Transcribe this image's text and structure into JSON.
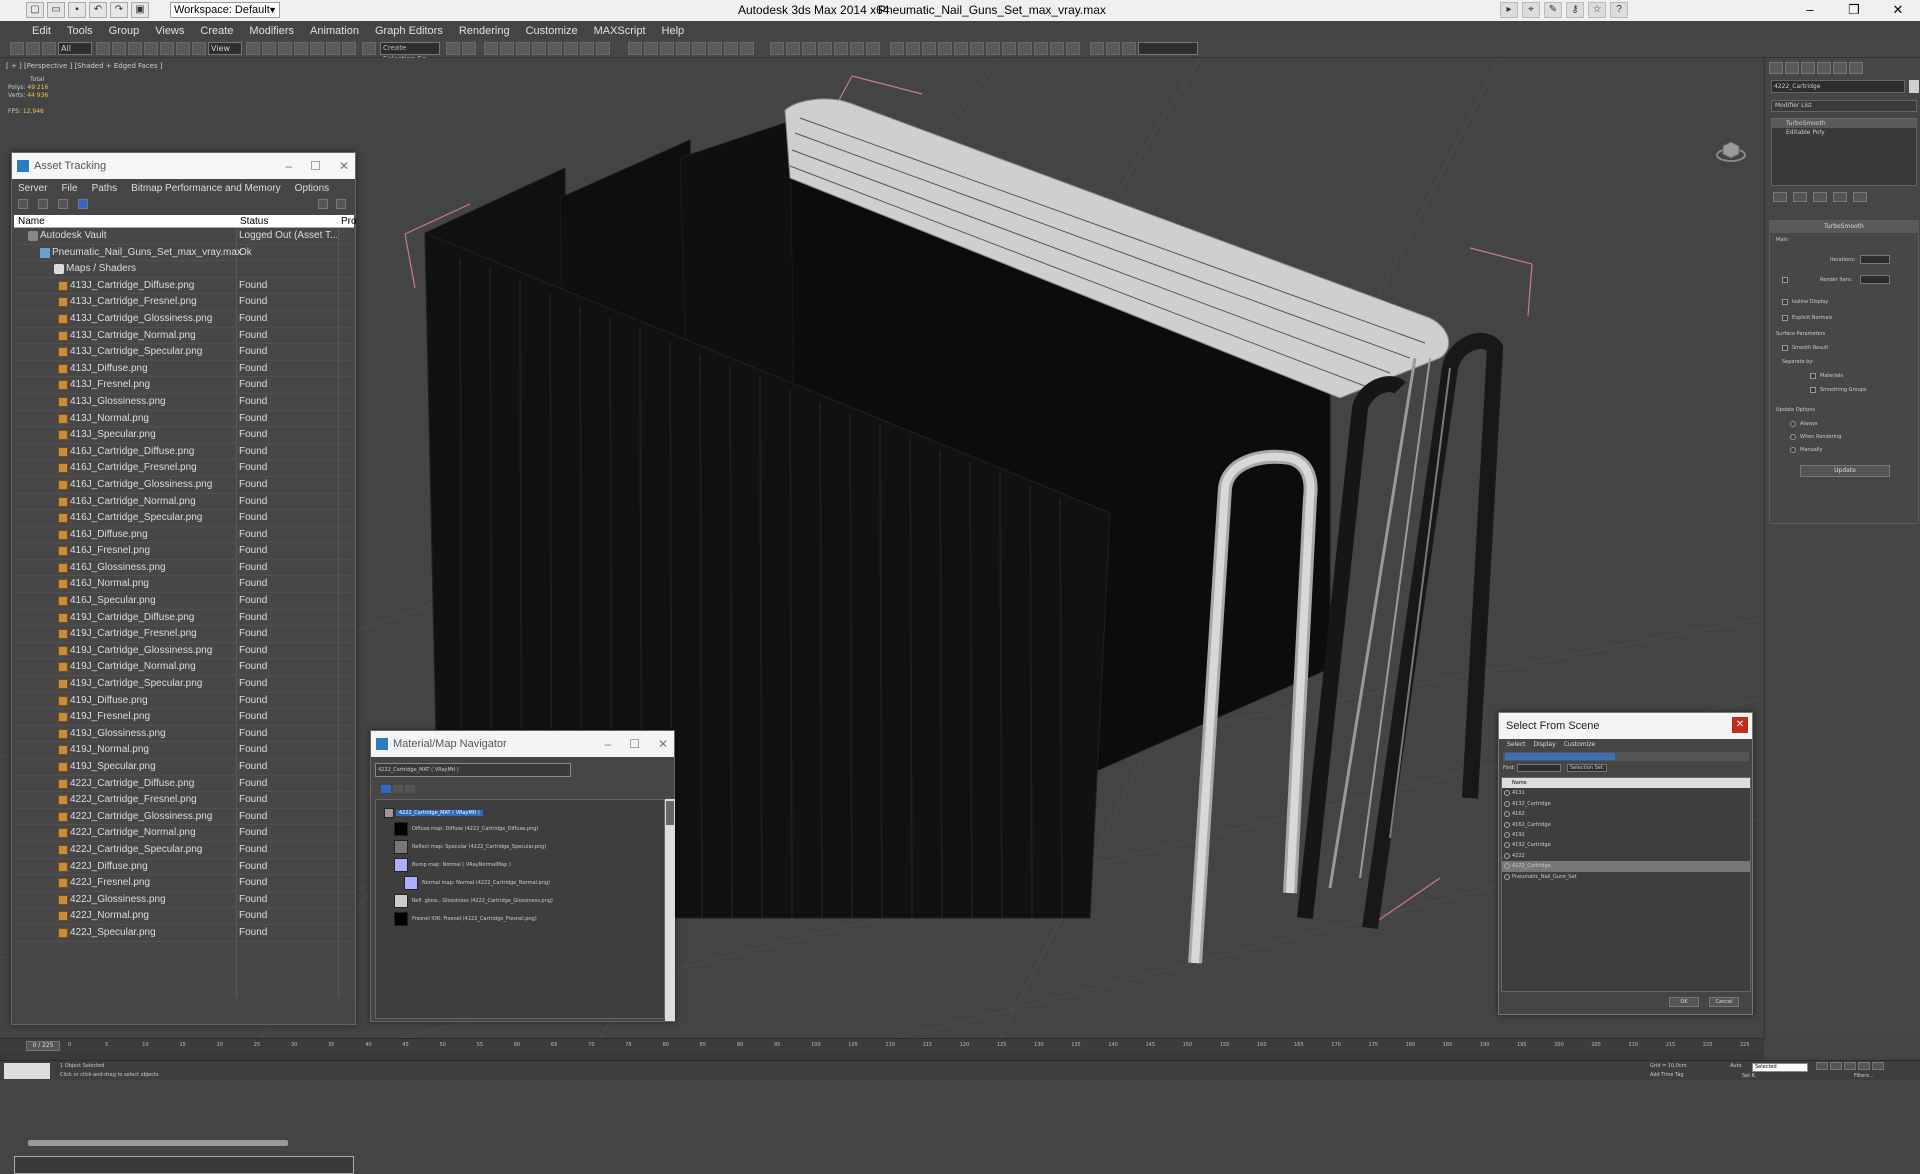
{
  "titlebar": {
    "workspace": "Workspace: Default",
    "app_title": "Autodesk 3ds Max  2014 x64",
    "doc_name": "Pneumatic_Nail_Guns_Set_max_vray.max"
  },
  "menubar": {
    "items": [
      "Edit",
      "Tools",
      "Group",
      "Views",
      "Create",
      "Modifiers",
      "Animation",
      "Graph Editors",
      "Rendering",
      "Customize",
      "MAXScript",
      "Help"
    ]
  },
  "toolbar": {
    "selection_filter": "All",
    "ref_coord": "View",
    "named_sel": "Create Selection Se"
  },
  "viewport": {
    "label": "[ + ] [Perspective ] [Shaded + Edged Faces ]",
    "stats_total": "Total",
    "stats_polys_label": "Polys:",
    "stats_polys": "49 216",
    "stats_verts_label": "Verts:",
    "stats_verts": "44 936",
    "stats_fps_label": "FPS:",
    "stats_fps": "12,946"
  },
  "command_panel": {
    "object_name": "4222_Cartridge",
    "modifier_list": "Modifier List",
    "stack": [
      "TurboSmooth",
      "Editable Poly"
    ],
    "turbosmooth_title": "TurboSmooth",
    "main": "Main",
    "iterations": "Iterations:",
    "render_iters": "Render Iters:",
    "isoline": "Isoline Display",
    "explicit": "Explicit Normals",
    "surface_params": "Surface Parameters",
    "smooth_result": "Smooth Result",
    "separate_by": "Separate by:",
    "materials": "Materials",
    "smoothing_groups": "Smoothing Groups",
    "update_options": "Update Options",
    "always": "Always",
    "when_rendering": "When Rendering",
    "manually": "Manually",
    "update_btn": "Update"
  },
  "asset_tracking": {
    "title": "Asset Tracking",
    "menu": [
      "Server",
      "File",
      "Paths",
      "Bitmap Performance and Memory",
      "Options"
    ],
    "col_name": "Name",
    "col_status": "Status",
    "col_pro": "Pro",
    "vault": {
      "name": "Autodesk Vault",
      "status": "Logged Out (Asset T..."
    },
    "file": {
      "name": "Pneumatic_Nail_Guns_Set_max_vray.max",
      "status": "Ok"
    },
    "folder": "Maps / Shaders",
    "found": "Found",
    "maps": [
      "413J_Cartridge_Diffuse.png",
      "413J_Cartridge_Fresnel.png",
      "413J_Cartridge_Glossiness.png",
      "413J_Cartridge_Normal.png",
      "413J_Cartridge_Specular.png",
      "413J_Diffuse.png",
      "413J_Fresnel.png",
      "413J_Glossiness.png",
      "413J_Normal.png",
      "413J_Specular.png",
      "416J_Cartridge_Diffuse.png",
      "416J_Cartridge_Fresnel.png",
      "416J_Cartridge_Glossiness.png",
      "416J_Cartridge_Normal.png",
      "416J_Cartridge_Specular.png",
      "416J_Diffuse.png",
      "416J_Fresnel.png",
      "416J_Glossiness.png",
      "416J_Normal.png",
      "416J_Specular.png",
      "419J_Cartridge_Diffuse.png",
      "419J_Cartridge_Fresnel.png",
      "419J_Cartridge_Glossiness.png",
      "419J_Cartridge_Normal.png",
      "419J_Cartridge_Specular.png",
      "419J_Diffuse.png",
      "419J_Fresnel.png",
      "419J_Glossiness.png",
      "419J_Normal.png",
      "419J_Specular.png",
      "422J_Cartridge_Diffuse.png",
      "422J_Cartridge_Fresnel.png",
      "422J_Cartridge_Glossiness.png",
      "422J_Cartridge_Normal.png",
      "422J_Cartridge_Specular.png",
      "422J_Diffuse.png",
      "422J_Fresnel.png",
      "422J_Glossiness.png",
      "422J_Normal.png",
      "422J_Specular.png"
    ]
  },
  "material_navigator": {
    "title": "Material/Map Navigator",
    "material_field": "4222_Cartridge_MAT  ( VRayMtl )",
    "root": "4222_Cartridge_MAT  ( VRayMtl )",
    "rows": [
      "Diffuse map: Diffuse (4222_Cartridge_Diffuse.png)",
      "Reflect map: Specular (4222_Cartridge_Specular.png)",
      "Bump map: Normal  ( VRayNormalMap )",
      "Normal map: Normal (4222_Cartridge_Normal.png)",
      "Refl. gloss.: Glossiness (4222_Cartridge_Glossiness.png)",
      "Fresnel IOR: Fresnel (4222_Cartridge_Fresnel.png)"
    ]
  },
  "select_from_scene": {
    "title": "Select From Scene",
    "menu": [
      "Select",
      "Display",
      "Customize"
    ],
    "find": "Find:",
    "selection_set": "Selection Set:",
    "col_name": "Name",
    "items": [
      "4131",
      "4132_Cartridge",
      "4162",
      "4162_Cartridge",
      "4192",
      "4192_Cartridge",
      "4222",
      "4222_Cartridge",
      "Pneumatic_Nail_Guns_Set"
    ],
    "selected_index": 7,
    "ok": "OK",
    "cancel": "Cancel"
  },
  "timeline": {
    "slider": "0 / 225",
    "ticks": [
      "0",
      "5",
      "10",
      "15",
      "20",
      "25",
      "30",
      "35",
      "40",
      "45",
      "50",
      "55",
      "60",
      "65",
      "70",
      "75",
      "80",
      "85",
      "90",
      "95",
      "100",
      "105",
      "110",
      "115",
      "120",
      "125",
      "130",
      "135",
      "140",
      "145",
      "150",
      "155",
      "160",
      "165",
      "170",
      "175",
      "180",
      "185",
      "190",
      "195",
      "200",
      "205",
      "210",
      "215",
      "220",
      "225"
    ]
  },
  "statusbar": {
    "line1": "1 Object Selected",
    "line2": "Click or click-and-drag to select objects",
    "grid": "Grid = 10,0cm",
    "add_time_tag": "Add Time Tag",
    "auto": "Auto",
    "selected": "Selected",
    "set_k": "Set K.",
    "filters": "Filters..."
  }
}
